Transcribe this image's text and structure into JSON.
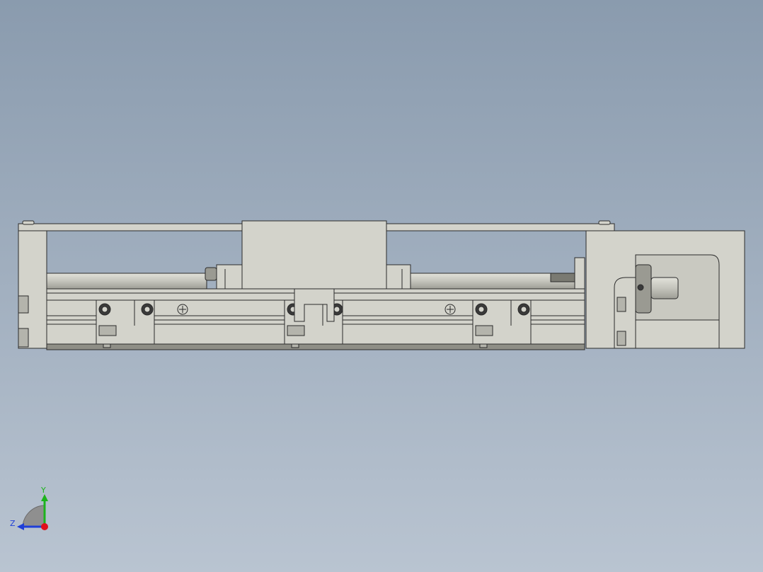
{
  "viewport": {
    "background_top": "#8a9bae",
    "background_bottom": "#b9c4d1",
    "part_fill": "#d3d3cb",
    "part_shade": "#b4b4ac",
    "edge_color": "#2b2b2b"
  },
  "triad": {
    "y_label": "Y",
    "z_label": "Z",
    "y_color": "#1db31d",
    "z_color": "#1f3fd8",
    "origin_color": "#e0101a"
  }
}
